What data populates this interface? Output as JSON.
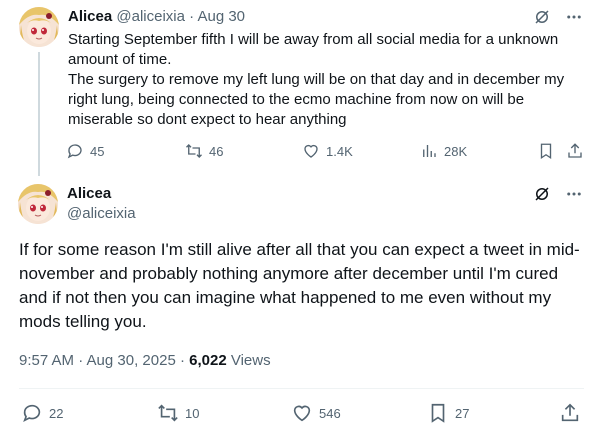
{
  "tweet1": {
    "author_name": "Alicea",
    "handle": "@aliceixia",
    "separator": "·",
    "date": "Aug 30",
    "paragraphs": [
      "Starting September fifth I will be away from all social media for a unknown amount of time.",
      "The surgery to remove my left lung will be on that day and in december my right lung, being connected to the ecmo machine from now on will be miserable so dont expect to hear anything"
    ],
    "stats": {
      "replies": "45",
      "reposts": "46",
      "likes": "1.4K",
      "views": "28K"
    }
  },
  "tweet2": {
    "author_name": "Alicea",
    "handle": "@aliceixia",
    "body": "If for some reason I'm still alive after all that you can expect a tweet in mid-november and probably nothing anymore after december until I'm cured and if not then you can imagine what happened to me even without my mods telling you.",
    "timestamp": "9:57 AM · Aug 30, 2025",
    "separator": "·",
    "views_count": "6,022",
    "views_label": "Views",
    "stats": {
      "replies": "22",
      "reposts": "10",
      "likes": "546",
      "bookmarks": "27"
    }
  },
  "icons": {
    "grok": "grok-slash-icon",
    "more": "more-dots-icon",
    "reply": "reply-bubble-icon",
    "repost": "repost-arrows-icon",
    "like": "heart-icon",
    "views": "bar-chart-icon",
    "bookmark": "bookmark-icon",
    "share": "share-upload-icon"
  },
  "colors": {
    "text": "#0f1419",
    "muted": "#536471",
    "thread_line": "#cfd9de"
  }
}
